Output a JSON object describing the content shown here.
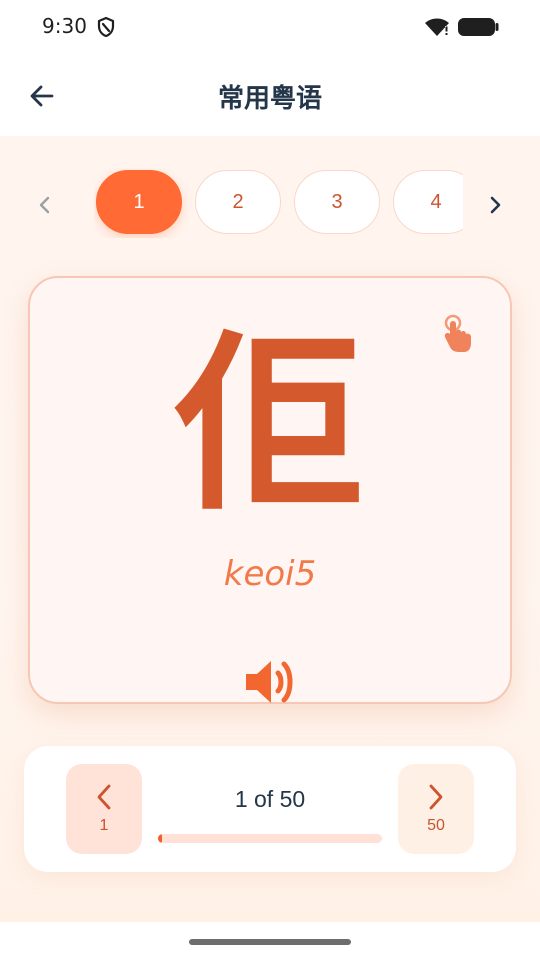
{
  "status_bar": {
    "time": "9:30"
  },
  "app_bar": {
    "title": "常用粤语"
  },
  "pager": {
    "pages": [
      "1",
      "2",
      "3",
      "4"
    ],
    "active_index": 0
  },
  "card": {
    "character": "佢",
    "romanization": "keoi5"
  },
  "navigation": {
    "prev_label": "1",
    "next_label": "50",
    "progress_text": "1 of 50",
    "progress_fraction": 0.02
  },
  "colors": {
    "accent": "#ff6a35",
    "character": "#d4592d",
    "romanization": "#f27a4a",
    "title": "#24364a"
  },
  "icons": {
    "back": "arrow-left-icon",
    "tap": "tap-hand-icon",
    "speaker": "speaker-icon",
    "prev": "chevron-left-icon",
    "next": "chevron-right-icon"
  }
}
